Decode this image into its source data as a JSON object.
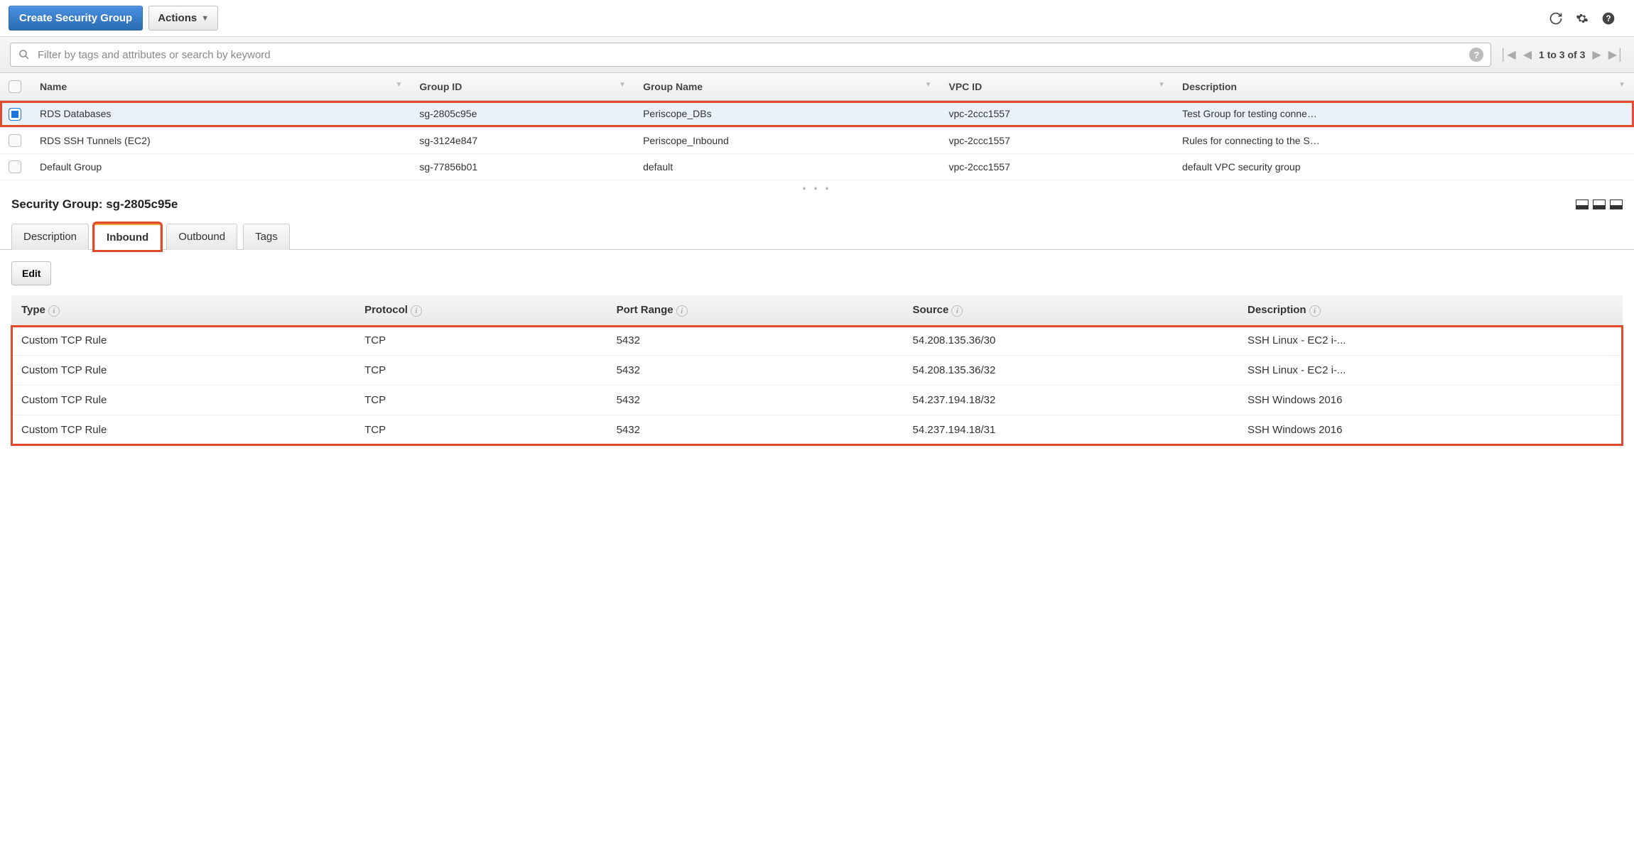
{
  "toolbar": {
    "create_label": "Create Security Group",
    "actions_label": "Actions"
  },
  "search": {
    "placeholder": "Filter by tags and attributes or search by keyword"
  },
  "pager": {
    "text": "1 to 3 of 3"
  },
  "columns": {
    "name": "Name",
    "group_id": "Group ID",
    "group_name": "Group Name",
    "vpc_id": "VPC ID",
    "description": "Description"
  },
  "rows": [
    {
      "selected": true,
      "name": "RDS Databases",
      "group_id": "sg-2805c95e",
      "group_name": "Periscope_DBs",
      "vpc_id": "vpc-2ccc1557",
      "description": "Test Group for testing conne…"
    },
    {
      "selected": false,
      "name": "RDS SSH Tunnels (EC2)",
      "group_id": "sg-3124e847",
      "group_name": "Periscope_Inbound",
      "vpc_id": "vpc-2ccc1557",
      "description": "Rules for connecting to the S…"
    },
    {
      "selected": false,
      "name": "Default Group",
      "group_id": "sg-77856b01",
      "group_name": "default",
      "vpc_id": "vpc-2ccc1557",
      "description": "default VPC security group"
    }
  ],
  "detail": {
    "header_prefix": "Security Group: ",
    "header_id": "sg-2805c95e",
    "tabs": {
      "description": "Description",
      "inbound": "Inbound",
      "outbound": "Outbound",
      "tags": "Tags"
    },
    "edit_label": "Edit",
    "rule_columns": {
      "type": "Type",
      "protocol": "Protocol",
      "port_range": "Port Range",
      "source": "Source",
      "description": "Description"
    },
    "rules": [
      {
        "type": "Custom TCP Rule",
        "protocol": "TCP",
        "port_range": "5432",
        "source": "54.208.135.36/30",
        "description": "SSH Linux - EC2 i-..."
      },
      {
        "type": "Custom TCP Rule",
        "protocol": "TCP",
        "port_range": "5432",
        "source": "54.208.135.36/32",
        "description": "SSH Linux - EC2 i-..."
      },
      {
        "type": "Custom TCP Rule",
        "protocol": "TCP",
        "port_range": "5432",
        "source": "54.237.194.18/32",
        "description": "SSH Windows 2016"
      },
      {
        "type": "Custom TCP Rule",
        "protocol": "TCP",
        "port_range": "5432",
        "source": "54.237.194.18/31",
        "description": "SSH Windows 2016"
      }
    ]
  }
}
